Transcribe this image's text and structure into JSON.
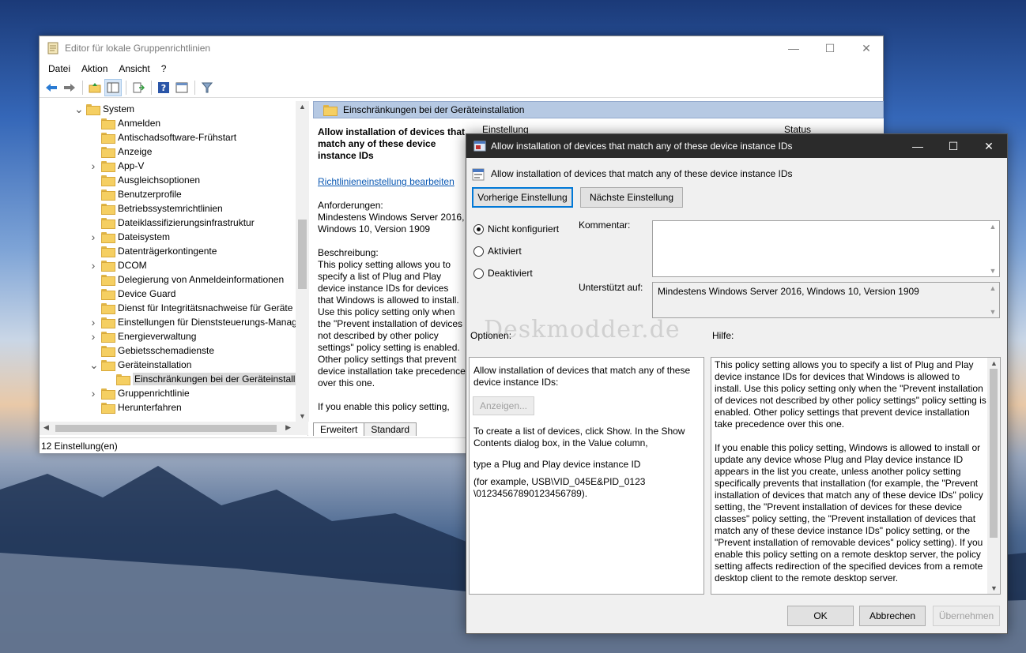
{
  "main_window": {
    "title": "Editor für lokale Gruppenrichtlinien",
    "menu": [
      "Datei",
      "Aktion",
      "Ansicht",
      "?"
    ],
    "toolbar_icons": [
      "back-arrow-icon",
      "forward-arrow-icon",
      "up-folder-icon",
      "show-hide-tree-icon",
      "export-list-icon",
      "help-icon",
      "properties-icon",
      "filter-icon"
    ],
    "tree": [
      {
        "label": "System",
        "level": 0,
        "expander": "expanded"
      },
      {
        "label": "Anmelden",
        "level": 1,
        "expander": "none"
      },
      {
        "label": "Antischadsoftware-Frühstart",
        "level": 1,
        "expander": "none"
      },
      {
        "label": "Anzeige",
        "level": 1,
        "expander": "none"
      },
      {
        "label": "App-V",
        "level": 1,
        "expander": "collapsed"
      },
      {
        "label": "Ausgleichsoptionen",
        "level": 1,
        "expander": "none"
      },
      {
        "label": "Benutzerprofile",
        "level": 1,
        "expander": "none"
      },
      {
        "label": "Betriebssystemrichtlinien",
        "level": 1,
        "expander": "none"
      },
      {
        "label": "Dateiklassifizierungsinfrastruktur",
        "level": 1,
        "expander": "none"
      },
      {
        "label": "Dateisystem",
        "level": 1,
        "expander": "collapsed"
      },
      {
        "label": "Datenträgerkontingente",
        "level": 1,
        "expander": "none"
      },
      {
        "label": "DCOM",
        "level": 1,
        "expander": "collapsed"
      },
      {
        "label": "Delegierung von Anmeldeinformationen",
        "level": 1,
        "expander": "none"
      },
      {
        "label": "Device Guard",
        "level": 1,
        "expander": "none"
      },
      {
        "label": "Dienst für Integritätsnachweise für Geräte",
        "level": 1,
        "expander": "none"
      },
      {
        "label": "Einstellungen für Dienststeuerungs-Manag",
        "level": 1,
        "expander": "collapsed"
      },
      {
        "label": "Energieverwaltung",
        "level": 1,
        "expander": "collapsed"
      },
      {
        "label": "Gebietsschemadienste",
        "level": 1,
        "expander": "none"
      },
      {
        "label": "Geräteinstallation",
        "level": 1,
        "expander": "expanded"
      },
      {
        "label": "Einschränkungen bei der Geräteinstalla",
        "level": 2,
        "expander": "none",
        "selected": true
      },
      {
        "label": "Gruppenrichtlinie",
        "level": 1,
        "expander": "collapsed"
      },
      {
        "label": "Herunterfahren",
        "level": 1,
        "expander": "none"
      }
    ],
    "right_header": "Einschränkungen bei der Geräteinstallation",
    "columns": {
      "setting": "Einstellung",
      "status": "Status"
    },
    "desc_title": "Allow installation of devices that match any of these device instance IDs",
    "desc_link": "Richtlinieneinstellung bearbeiten",
    "desc_req_label": "Anforderungen:",
    "desc_req_value": "Mindestens Windows Server 2016, Windows 10, Version 1909",
    "desc_label": "Beschreibung:",
    "desc_body": "This policy setting allows you to specify a list of Plug and Play device instance IDs for devices that Windows is allowed to install. Use this policy setting only when the \"Prevent installation of devices not described by other policy settings\" policy setting is enabled. Other policy settings that prevent device installation take precedence over this one.",
    "desc_body2": "If you enable this policy setting, Windows is allowed to install or",
    "tabs": [
      "Erweitert",
      "Standard"
    ],
    "status_bar": "12 Einstellung(en)"
  },
  "dialog": {
    "title": "Allow installation of devices that match any of these device instance IDs",
    "subtitle": "Allow installation of devices that match any of these device instance IDs",
    "prev_button": "Vorherige Einstellung",
    "next_button": "Nächste Einstellung",
    "radio": [
      {
        "label": "Nicht konfiguriert",
        "checked": true
      },
      {
        "label": "Aktiviert",
        "checked": false
      },
      {
        "label": "Deaktiviert",
        "checked": false
      }
    ],
    "comment_label": "Kommentar:",
    "comment_value": "",
    "supported_label": "Unterstützt auf:",
    "supported_value": "Mindestens Windows Server 2016, Windows 10, Version 1909",
    "options_label": "Optionen:",
    "help_label": "Hilfe:",
    "watermark": "Deskmodder.de",
    "options": {
      "line1": "Allow installation of devices that match any of these device instance IDs:",
      "show_button": "Anzeigen...",
      "line2": "To create a list of devices, click Show. In the Show Contents dialog box, in the Value column,",
      "line3": "type a Plug and Play device instance ID",
      "line4": "(for example, USB\\VID_045E&PID_0123 \\01234567890123456789)."
    },
    "help": {
      "p1": "This policy setting allows you to specify a list of Plug and Play device instance IDs for devices that Windows is allowed to install. Use this policy setting only when the \"Prevent installation of devices not described by other policy settings\" policy setting is enabled. Other policy settings that prevent device installation take precedence over this one.",
      "p2": "If you enable this policy setting, Windows is allowed to install or update any device whose Plug and Play device instance ID appears in the list you create, unless another policy setting specifically prevents that installation (for example, the \"Prevent installation of devices that match any of these device IDs\" policy setting, the \"Prevent installation of devices for these device classes\" policy setting, the \"Prevent installation of devices that match any of these device instance IDs\" policy setting, or the \"Prevent installation of removable devices\" policy setting). If you enable this policy setting on a remote desktop server, the policy setting affects redirection of the specified devices from a remote desktop client to the remote desktop server."
    },
    "ok": "OK",
    "cancel": "Abbrechen",
    "apply": "Übernehmen"
  }
}
